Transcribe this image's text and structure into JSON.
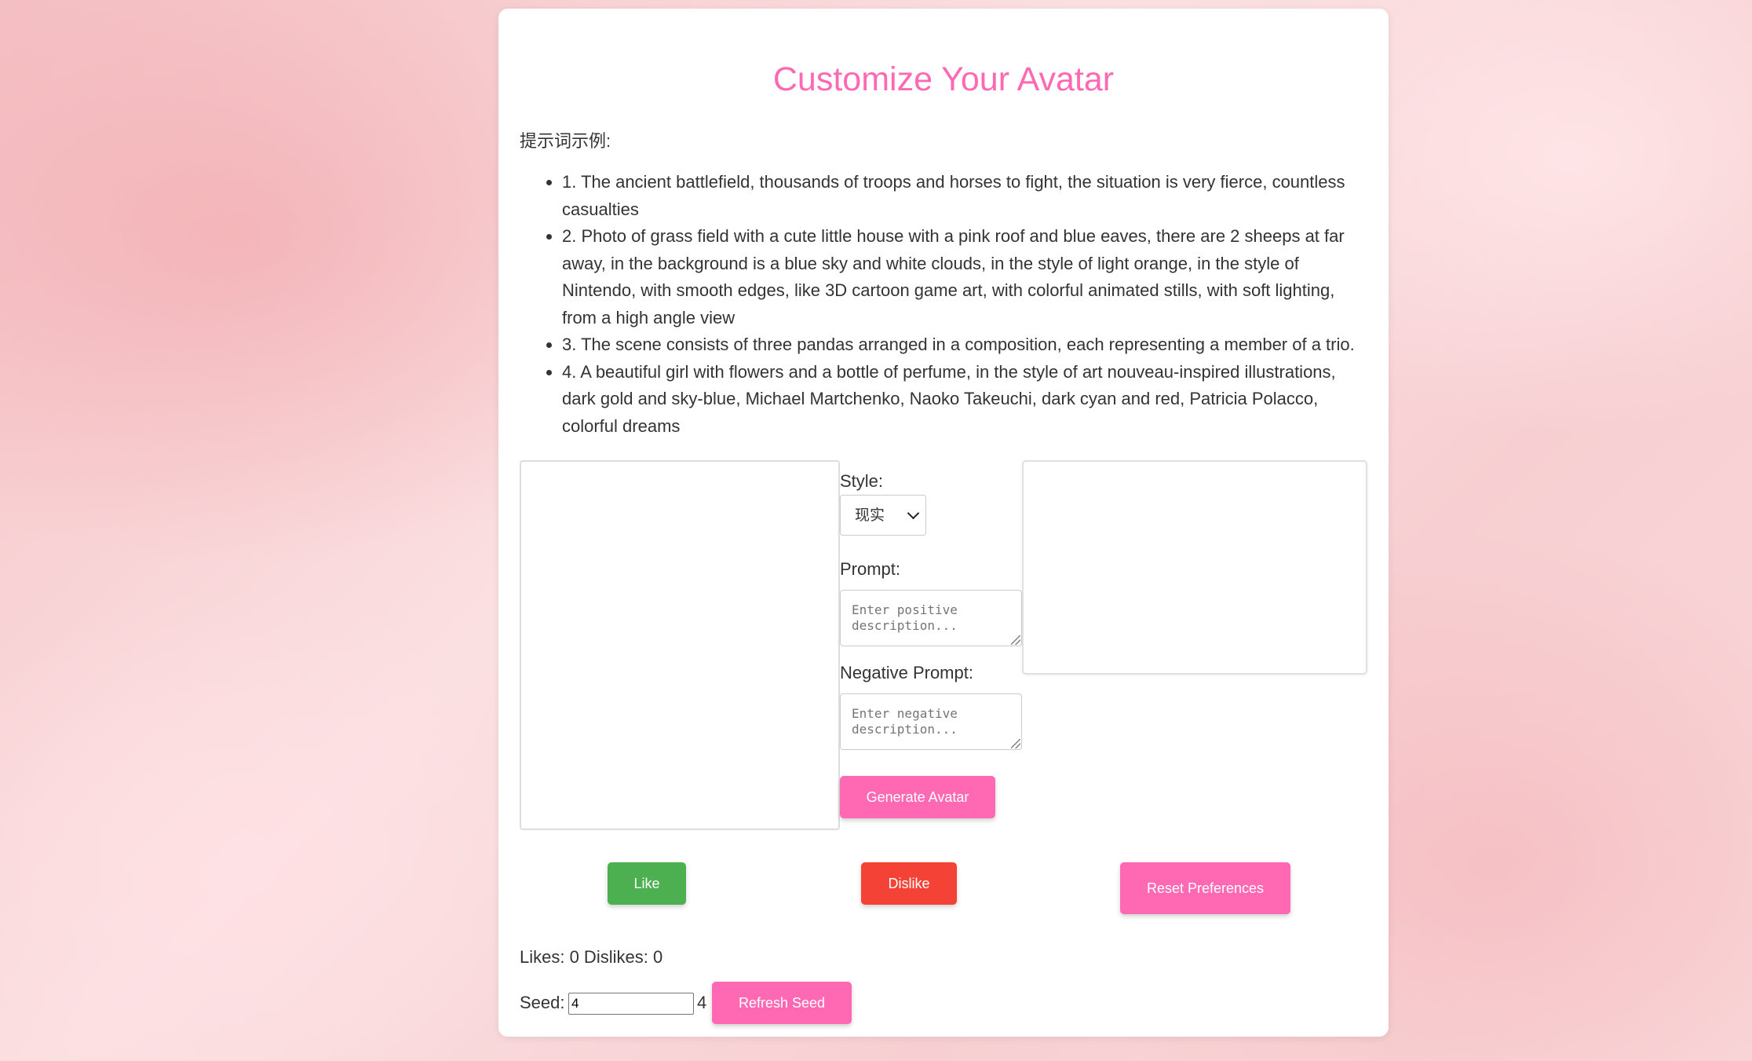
{
  "page": {
    "title": "Customize Your Avatar",
    "examples_label": "提示词示例:",
    "examples": [
      "1. The ancient battlefield, thousands of troops and horses to fight, the situation is very fierce, countless casualties",
      "2. Photo of grass field with a cute little house with a pink roof and blue eaves, there are 2 sheeps at far away, in the background is a blue sky and white clouds, in the style of light orange, in the style of Nintendo, with smooth edges, like 3D cartoon game art, with colorful animated stills, with soft lighting, from a high angle view",
      "3. The scene consists of three pandas arranged in a composition, each representing a member of a trio.",
      "4. A beautiful girl with flowers and a bottle of perfume, in the style of art nouveau-inspired illustrations, dark gold and sky-blue, Michael Martchenko, Naoko Takeuchi, dark cyan and red, Patricia Polacco, colorful dreams"
    ]
  },
  "controls": {
    "style_label": "Style:",
    "style_value": "现实",
    "prompt_label": "Prompt:",
    "prompt_placeholder": "Enter positive description...",
    "negative_label": "Negative Prompt:",
    "negative_placeholder": "Enter negative description...",
    "generate_label": "Generate Avatar"
  },
  "feedback": {
    "like_label": "Like",
    "dislike_label": "Dislike",
    "reset_label": "Reset Preferences",
    "stats_text": "Likes: 0 Dislikes: 0"
  },
  "seed": {
    "label": "Seed:",
    "input_value": "4",
    "display_value": "4",
    "refresh_label": "Refresh Seed"
  },
  "colors": {
    "accent": "#ff69b4",
    "like": "#4caf50",
    "dislike": "#f44336"
  },
  "icons": {
    "select_arrow": "chevron-down-icon"
  }
}
